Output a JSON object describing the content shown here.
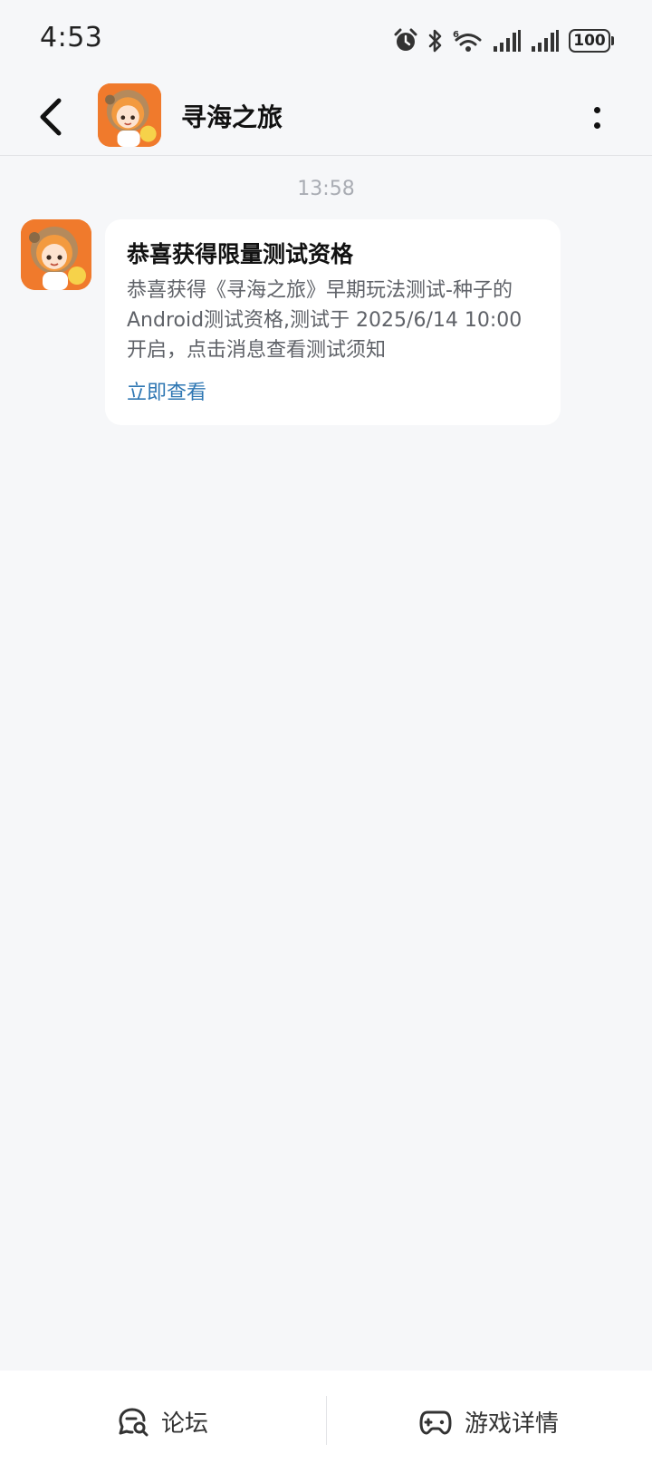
{
  "status_bar": {
    "time": "4:53",
    "battery": "100",
    "icons": [
      "alarm-icon",
      "bluetooth-icon",
      "wifi-6-icon",
      "signal-icon",
      "signal-icon"
    ]
  },
  "header": {
    "title": "寻海之旅",
    "back_icon": "chevron-left-icon",
    "more_icon": "more-vertical-icon",
    "avatar": "game-avatar"
  },
  "conversation": {
    "timestamp": "13:58",
    "message": {
      "title": "恭喜获得限量测试资格",
      "body": "恭喜获得《寻海之旅》早期玩法测试-种子的\nAndroid测试资格,测试于 2025/6/14 10:00\n开启，点击消息查看测试须知",
      "action": "立即查看"
    }
  },
  "bottom_bar": {
    "forum_label": "论坛",
    "game_details_label": "游戏详情"
  },
  "colors": {
    "background": "#f6f7f9",
    "link": "#2f77b3",
    "avatar_orange": "#f07a2c"
  }
}
